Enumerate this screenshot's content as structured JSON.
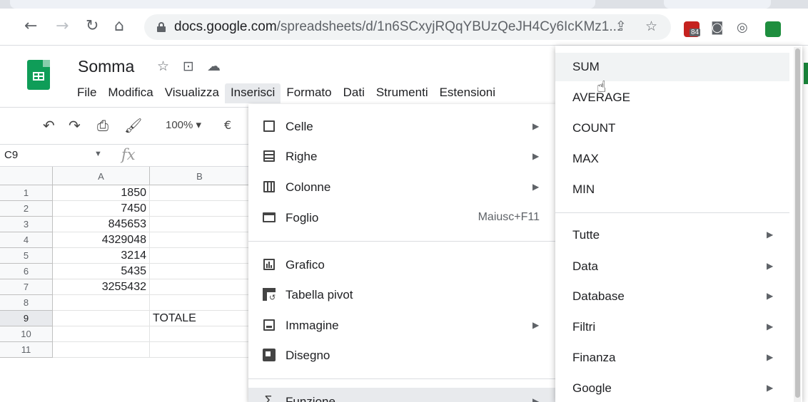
{
  "browser": {
    "url_domain": "docs.google.com",
    "url_path": "/spreadsheets/d/1n6SCxyjRQqYBUzQeJH4Cy6IcKMz1...",
    "extension_badge": "84"
  },
  "doc": {
    "title": "Somma",
    "menus": [
      "File",
      "Modifica",
      "Visualizza",
      "Inserisci",
      "Formato",
      "Dati",
      "Strumenti",
      "Estensioni"
    ]
  },
  "toolbar": {
    "zoom": "100%",
    "currency": "€"
  },
  "formula_bar": {
    "namebox": "C9",
    "fx": "fx"
  },
  "grid": {
    "columns": [
      "A",
      "B"
    ],
    "rows": [
      {
        "n": "1",
        "a": "1850",
        "b": ""
      },
      {
        "n": "2",
        "a": "7450",
        "b": ""
      },
      {
        "n": "3",
        "a": "845653",
        "b": ""
      },
      {
        "n": "4",
        "a": "4329048",
        "b": ""
      },
      {
        "n": "5",
        "a": "3214",
        "b": ""
      },
      {
        "n": "6",
        "a": "5435",
        "b": ""
      },
      {
        "n": "7",
        "a": "3255432",
        "b": ""
      },
      {
        "n": "8",
        "a": "",
        "b": ""
      },
      {
        "n": "9",
        "a": "",
        "b": "TOTALE"
      },
      {
        "n": "10",
        "a": "",
        "b": ""
      },
      {
        "n": "11",
        "a": "",
        "b": ""
      }
    ]
  },
  "insert_menu": {
    "items": [
      {
        "label": "Celle",
        "icon": "cell-icon",
        "arrow": true
      },
      {
        "label": "Righe",
        "icon": "rows-icon",
        "arrow": true
      },
      {
        "label": "Colonne",
        "icon": "columns-icon",
        "arrow": true
      },
      {
        "label": "Foglio",
        "icon": "sheet-icon",
        "shortcut": "Maiusc+F11"
      },
      {
        "label": "Grafico",
        "icon": "chart-icon"
      },
      {
        "label": "Tabella pivot",
        "icon": "pivot-icon"
      },
      {
        "label": "Immagine",
        "icon": "image-icon",
        "arrow": true
      },
      {
        "label": "Disegno",
        "icon": "drawing-icon"
      },
      {
        "label": "Funzione",
        "icon": "sigma-icon",
        "arrow": true
      }
    ]
  },
  "function_menu": {
    "quick": [
      "SUM",
      "AVERAGE",
      "COUNT",
      "MAX",
      "MIN"
    ],
    "categories": [
      "Tutte",
      "Data",
      "Database",
      "Filtri",
      "Finanza",
      "Google"
    ]
  }
}
